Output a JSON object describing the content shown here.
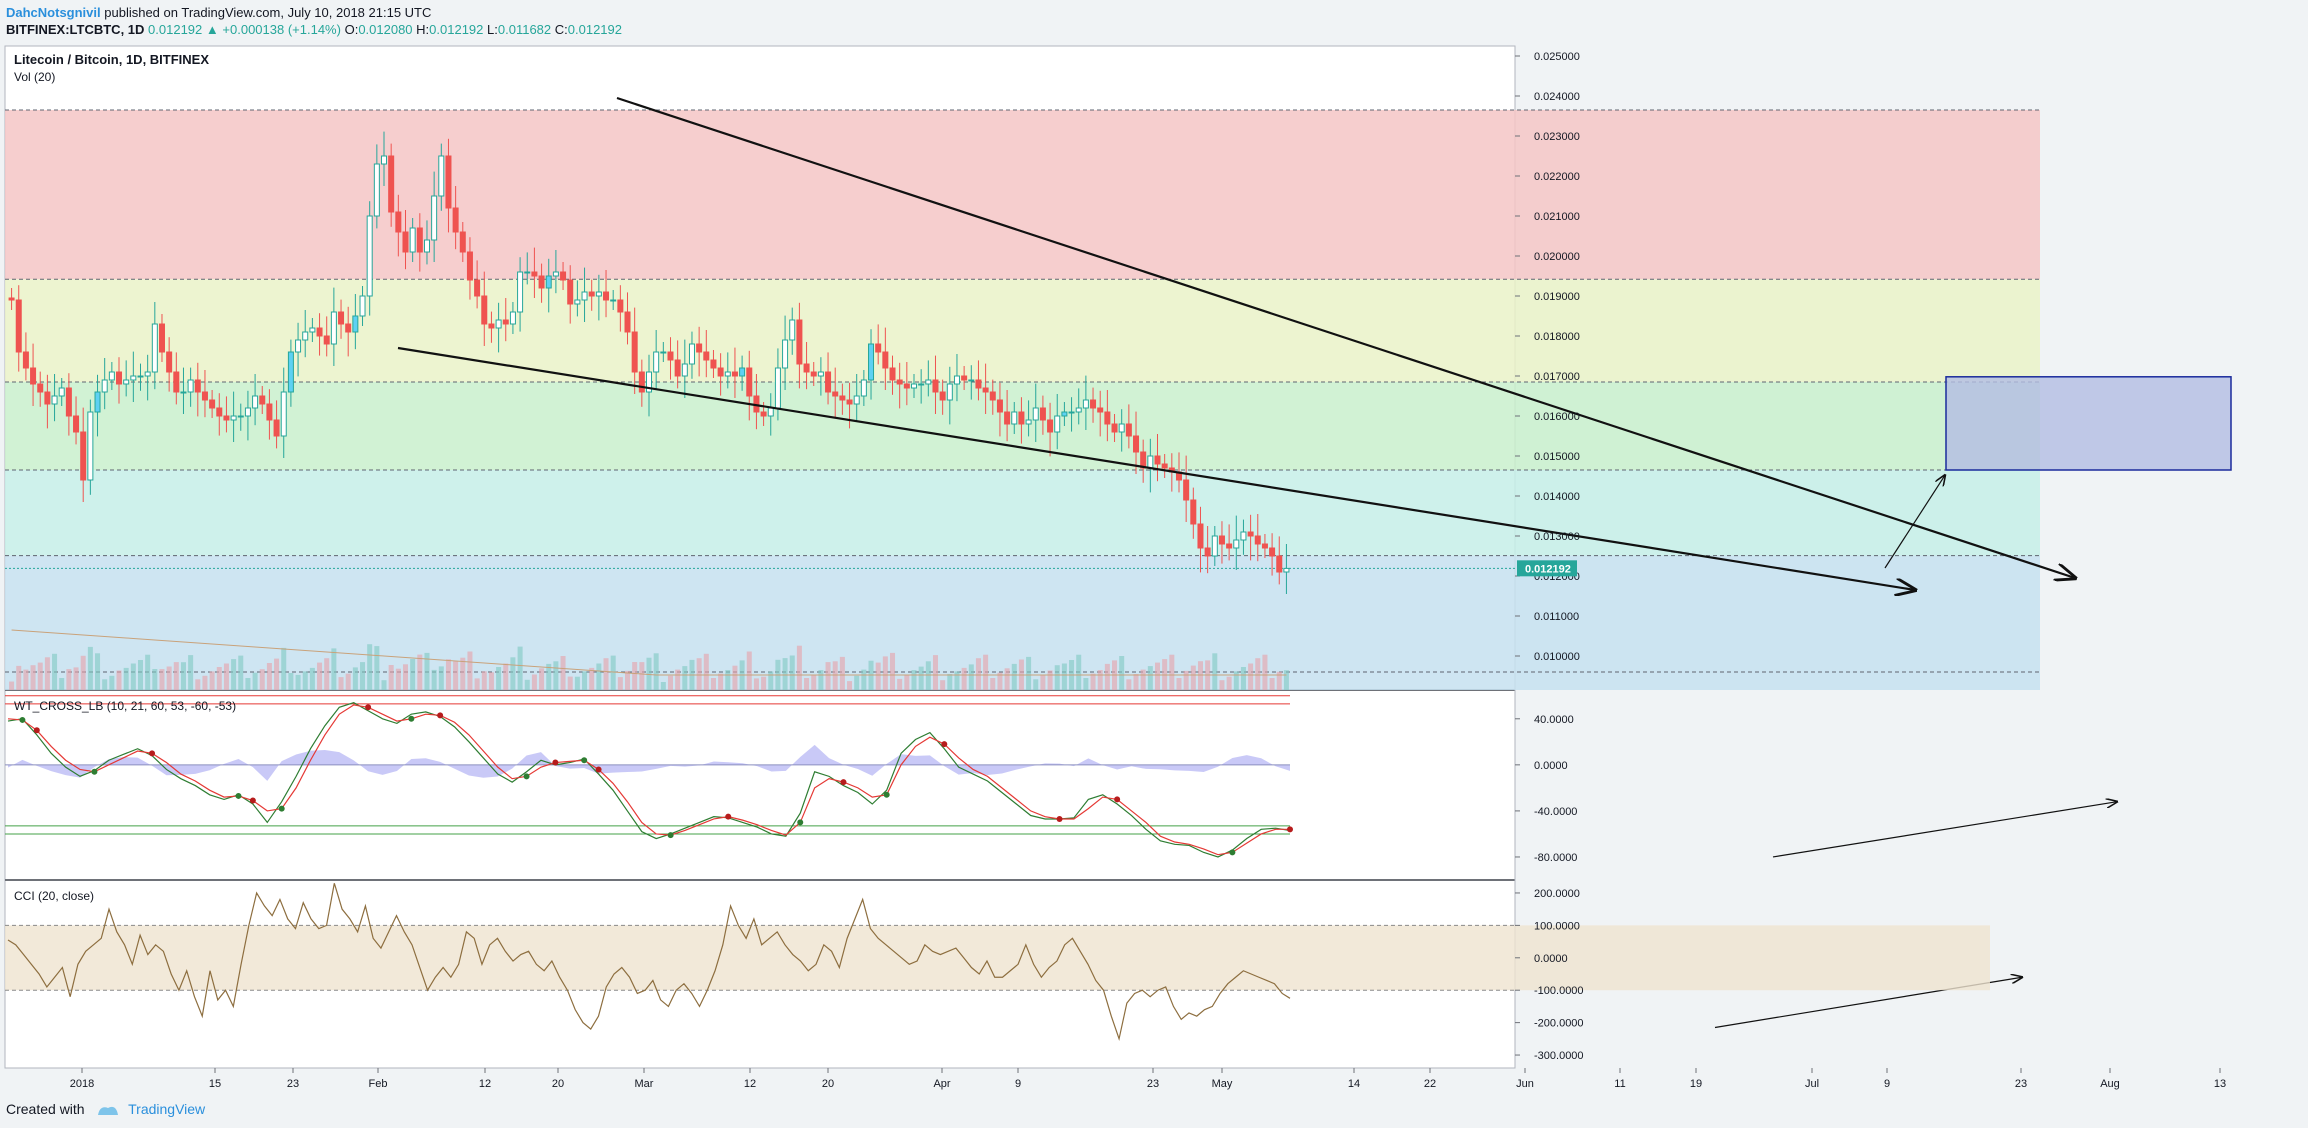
{
  "header": {
    "author": "DahcNotsgnivil",
    "published_text": "published on TradingView.com, July 10, 2018 21:15 UTC",
    "symbol": "BITFINEX:LTCBTC, 1D",
    "last": "0.012192",
    "change": "+0.000138 (+1.14%)",
    "open_label": "O:",
    "open": "0.012080",
    "high_label": "H:",
    "high": "0.012192",
    "low_label": "L:",
    "low": "0.011682",
    "close_label": "C:",
    "close": "0.012192"
  },
  "pane_labels": {
    "main_title": "Litecoin / Bitcoin, 1D, BITFINEX",
    "volume": "Vol (20)",
    "wt": "WT_CROSS_LB (10, 21, 60, 53, -60, -53)",
    "cci": "CCI (20, close)"
  },
  "footer": {
    "created_with": "Created with",
    "brand": "TradingView"
  },
  "colors": {
    "up": "#26a69a",
    "down": "#ef5350",
    "up_fill": "#5ed1f2",
    "hl": "#f0e68c",
    "zone_red": "#f4c6c6",
    "zone_yellow": "#eaf2c8",
    "zone_green": "#c9f0cc",
    "zone_teal": "#c6efe8",
    "zone_blue": "#c6e1f0",
    "target_box": "#b3bde3",
    "wt1": "#2e7d32",
    "wt2": "#e53935",
    "wt_hist": "#9c9cf0",
    "cci_line": "#8d6e3f",
    "cci_band": "#efe3cf",
    "price_tag": "#26a69a"
  },
  "chart_data": [
    {
      "type": "candlestick",
      "title": "Litecoin / Bitcoin, 1D, BITFINEX",
      "y_axis": {
        "ticks": [
          "0.025000",
          "0.024000",
          "0.023000",
          "0.022000",
          "0.021000",
          "0.020000",
          "0.019000",
          "0.018000",
          "0.017000",
          "0.016000",
          "0.015000",
          "0.014000",
          "0.013000",
          "0.012000",
          "0.011000",
          "0.010000"
        ],
        "range": [
          0.00915,
          0.02525
        ]
      },
      "x_axis": {
        "ticks": [
          "2018",
          "15",
          "23",
          "Feb",
          "12",
          "20",
          "Mar",
          "12",
          "20",
          "Apr",
          "9",
          "23",
          "May",
          "14",
          "22",
          "Jun",
          "11",
          "19",
          "Jul",
          "9",
          "23",
          "Aug",
          "13"
        ]
      },
      "current_price_label": "0.012192",
      "zones": [
        {
          "from": 0.01942,
          "to": 0.02365,
          "color": "red"
        },
        {
          "from": 0.01685,
          "to": 0.01942,
          "color": "yellow"
        },
        {
          "from": 0.01465,
          "to": 0.01685,
          "color": "green"
        },
        {
          "from": 0.01251,
          "to": 0.01465,
          "color": "teal"
        },
        {
          "from": 0.00915,
          "to": 0.01251,
          "color": "blue"
        }
      ],
      "zone_levels": [
        0.02365,
        0.01942,
        0.01685,
        0.01465,
        0.01251,
        0.0096
      ],
      "target_box": {
        "from": 0.01465,
        "to": 0.01698
      },
      "closes": [
        0.0189,
        0.0176,
        0.0172,
        0.0168,
        0.0166,
        0.0163,
        0.0165,
        0.0167,
        0.016,
        0.0156,
        0.0144,
        0.0161,
        0.0166,
        0.0169,
        0.0171,
        0.0168,
        0.0169,
        0.017,
        0.017,
        0.0171,
        0.0183,
        0.0176,
        0.0171,
        0.0166,
        0.0166,
        0.0169,
        0.0166,
        0.0164,
        0.0162,
        0.016,
        0.0159,
        0.016,
        0.016,
        0.0162,
        0.0165,
        0.0163,
        0.0159,
        0.0155,
        0.0166,
        0.0176,
        0.0179,
        0.0181,
        0.0182,
        0.018,
        0.0178,
        0.0186,
        0.0183,
        0.0181,
        0.0185,
        0.019,
        0.021,
        0.0223,
        0.0225,
        0.0211,
        0.0206,
        0.0201,
        0.0207,
        0.0201,
        0.0204,
        0.0215,
        0.0225,
        0.0212,
        0.0206,
        0.0201,
        0.0194,
        0.019,
        0.0183,
        0.0182,
        0.0184,
        0.0183,
        0.0186,
        0.0196,
        0.0196,
        0.0195,
        0.0192,
        0.0195,
        0.0196,
        0.0194,
        0.0188,
        0.0189,
        0.0191,
        0.019,
        0.0191,
        0.0189,
        0.0189,
        0.0186,
        0.0181,
        0.0171,
        0.0166,
        0.0171,
        0.0176,
        0.0176,
        0.0174,
        0.017,
        0.0173,
        0.0178,
        0.0176,
        0.0174,
        0.0172,
        0.017,
        0.0171,
        0.017,
        0.0172,
        0.0165,
        0.0161,
        0.016,
        0.0162,
        0.0172,
        0.0179,
        0.0184,
        0.0173,
        0.0171,
        0.017,
        0.0171,
        0.0166,
        0.0165,
        0.0164,
        0.0163,
        0.0165,
        0.0169,
        0.0178,
        0.0176,
        0.0172,
        0.0169,
        0.0168,
        0.0167,
        0.0168,
        0.0168,
        0.0169,
        0.0166,
        0.0164,
        0.0168,
        0.017,
        0.0169,
        0.0169,
        0.0167,
        0.0166,
        0.0164,
        0.0161,
        0.0158,
        0.0161,
        0.0158,
        0.0159,
        0.0162,
        0.0159,
        0.0156,
        0.016,
        0.0161,
        0.0161,
        0.0162,
        0.0164,
        0.0162,
        0.0161,
        0.0158,
        0.0156,
        0.0158,
        0.0155,
        0.0151,
        0.0147,
        0.015,
        0.0148,
        0.0147,
        0.0146,
        0.0144,
        0.0139,
        0.0133,
        0.0127,
        0.0125,
        0.013,
        0.0128,
        0.0127,
        0.0129,
        0.0131,
        0.013,
        0.0128,
        0.0127,
        0.0125,
        0.0121,
        0.01219
      ],
      "volume_line": "Vol (20) moving average"
    },
    {
      "type": "line",
      "title": "WT_CROSS_LB (10, 21, 60, 53, -60, -53)",
      "y_axis": {
        "ticks": [
          "40.0000",
          "0.0000",
          "-40.0000",
          "-80.0000"
        ],
        "range": [
          -100,
          65
        ]
      },
      "levels": [
        60,
        53,
        -53,
        -60
      ],
      "series": [
        {
          "values": [
            38,
            40,
            26,
            10,
            -2,
            -10,
            -5,
            4,
            9,
            14,
            8,
            -4,
            -12,
            -18,
            -26,
            -30,
            -26,
            -34,
            -50,
            -32,
            -10,
            14,
            34,
            50,
            54,
            47,
            40,
            36,
            44,
            46,
            42,
            33,
            20,
            6,
            -8,
            -15,
            -6,
            4,
            0,
            2,
            5,
            -8,
            -22,
            -40,
            -58,
            -64,
            -60,
            -55,
            -50,
            -45,
            -46,
            -50,
            -54,
            -60,
            -62,
            -42,
            -6,
            -10,
            -18,
            -24,
            -34,
            -22,
            10,
            22,
            28,
            14,
            -2,
            -8,
            -14,
            -24,
            -34,
            -44,
            -47,
            -47,
            -46,
            -30,
            -26,
            -34,
            -44,
            -56,
            -66,
            -69,
            -70,
            -76,
            -80,
            -74,
            -64,
            -56,
            -55,
            -57
          ]
        },
        {
          "values": [
            40,
            39,
            30,
            16,
            4,
            -4,
            -6,
            0,
            6,
            12,
            10,
            2,
            -8,
            -14,
            -22,
            -28,
            -27,
            -31,
            -40,
            -38,
            -20,
            4,
            26,
            44,
            52,
            50,
            44,
            38,
            40,
            44,
            43,
            37,
            26,
            12,
            -2,
            -12,
            -10,
            -2,
            2,
            3,
            4,
            -4,
            -16,
            -32,
            -50,
            -60,
            -61,
            -57,
            -52,
            -47,
            -45,
            -48,
            -52,
            -57,
            -61,
            -50,
            -20,
            -12,
            -15,
            -20,
            -28,
            -26,
            0,
            16,
            24,
            18,
            6,
            -4,
            -10,
            -20,
            -30,
            -40,
            -45,
            -47,
            -47,
            -38,
            -28,
            -30,
            -40,
            -50,
            -62,
            -67,
            -69,
            -73,
            -78,
            -76,
            -68,
            -60,
            -56,
            -56
          ]
        }
      ]
    },
    {
      "type": "line",
      "title": "CCI (20, close)",
      "y_axis": {
        "ticks": [
          "200.0000",
          "100.0000",
          "0.0000",
          "-100.0000",
          "-200.0000",
          "-300.0000"
        ],
        "range": [
          -340,
          240
        ]
      },
      "band": [
        -100,
        100
      ],
      "values": [
        55,
        40,
        10,
        -20,
        -50,
        -90,
        -60,
        -30,
        -120,
        -20,
        20,
        40,
        60,
        150,
        80,
        40,
        -20,
        70,
        10,
        40,
        20,
        -50,
        -100,
        -40,
        -120,
        -180,
        -40,
        -130,
        -100,
        -150,
        -20,
        100,
        200,
        160,
        130,
        180,
        120,
        90,
        170,
        120,
        90,
        100,
        230,
        150,
        120,
        80,
        160,
        60,
        30,
        80,
        130,
        80,
        40,
        -30,
        -100,
        -60,
        -30,
        -60,
        -20,
        80,
        60,
        -20,
        40,
        60,
        20,
        -10,
        10,
        20,
        -20,
        -40,
        -10,
        -60,
        -100,
        -160,
        -200,
        -220,
        -180,
        -90,
        -50,
        -30,
        -60,
        -110,
        -100,
        -70,
        -130,
        -150,
        -100,
        -80,
        -110,
        -150,
        -100,
        -40,
        40,
        160,
        100,
        60,
        120,
        40,
        60,
        80,
        40,
        10,
        -10,
        -40,
        -20,
        40,
        20,
        -30,
        60,
        120,
        180,
        90,
        60,
        40,
        20,
        0,
        -20,
        -10,
        40,
        20,
        10,
        20,
        30,
        0,
        -30,
        -50,
        -10,
        -60,
        -60,
        -40,
        -20,
        40,
        -20,
        -60,
        -30,
        -10,
        40,
        60,
        20,
        -20,
        -70,
        -100,
        -180,
        -250,
        -140,
        -110,
        -100,
        -120,
        -100,
        -90,
        -150,
        -190,
        -170,
        -180,
        -160,
        -150,
        -110,
        -80,
        -60,
        -40,
        -50,
        -60,
        -70,
        -80,
        -110,
        -125
      ]
    }
  ]
}
